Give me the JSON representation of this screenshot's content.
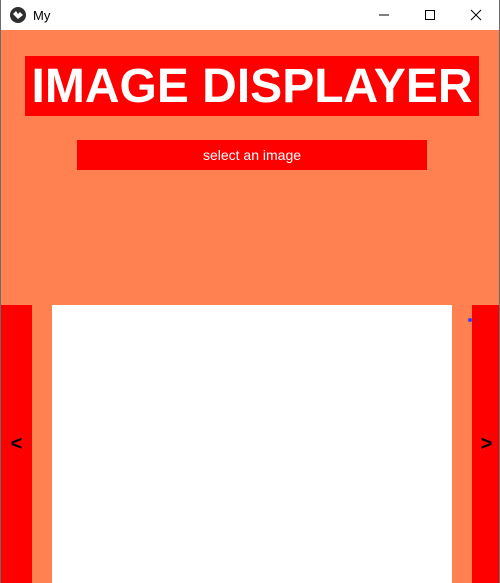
{
  "window": {
    "title": "My",
    "icons": {
      "app": "app-icon",
      "minimize": "minimize-icon",
      "maximize": "maximize-icon",
      "close": "close-icon"
    }
  },
  "app": {
    "header": "IMAGE DISPLAYER",
    "select_button_label": "select an image",
    "prev_label": "<",
    "next_label": ">"
  },
  "colors": {
    "background": "#ff8050",
    "accent": "#ff0000",
    "display": "#ffffff",
    "text_light": "#ffffff"
  }
}
